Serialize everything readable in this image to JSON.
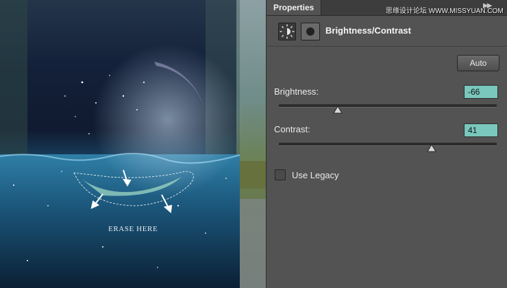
{
  "canvas": {
    "annotation": "ERASE HERE"
  },
  "panel": {
    "tab_label": "Properties",
    "collapse_icon": "double-chevron-right-icon",
    "watermark": "思缘设计论坛  WWW.MISSYUAN.COM",
    "adjustment_icon": "brightness-sun-icon",
    "mask_icon": "layer-mask-icon",
    "title": "Brightness/Contrast",
    "auto_label": "Auto",
    "brightness": {
      "label": "Brightness:",
      "value": "-66",
      "slider_fraction": 0.27
    },
    "contrast": {
      "label": "Contrast:",
      "value": "41",
      "slider_fraction": 0.7
    },
    "legacy": {
      "label": "Use Legacy",
      "checked": false
    },
    "colors": {
      "panel_bg": "#535353",
      "value_field": "#79c7bd"
    }
  }
}
